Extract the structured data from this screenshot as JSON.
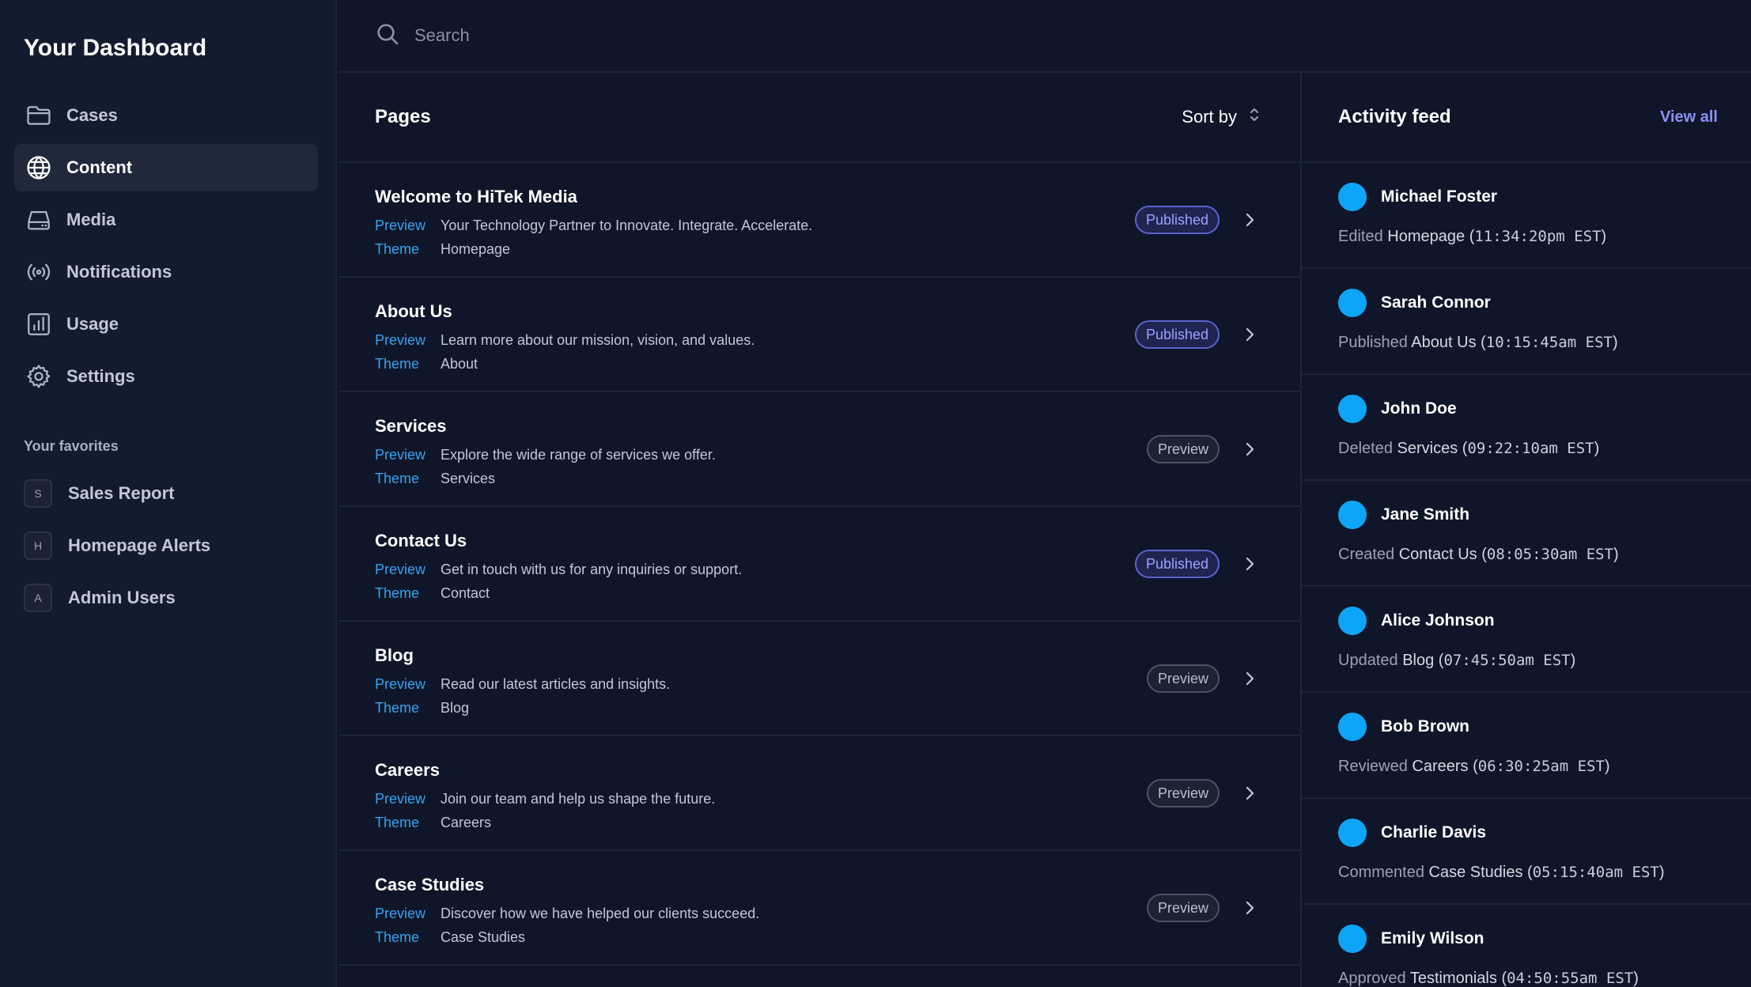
{
  "sidebar": {
    "title": "Your Dashboard",
    "items": [
      {
        "label": "Cases",
        "icon": "folder-icon"
      },
      {
        "label": "Content",
        "icon": "globe-icon"
      },
      {
        "label": "Media",
        "icon": "hard-drive-icon"
      },
      {
        "label": "Notifications",
        "icon": "signal-icon"
      },
      {
        "label": "Usage",
        "icon": "chart-icon"
      },
      {
        "label": "Settings",
        "icon": "gear-icon"
      }
    ],
    "active": "Content",
    "favorites_title": "Your favorites",
    "favorites": [
      {
        "initial": "S",
        "label": "Sales Report"
      },
      {
        "initial": "H",
        "label": "Homepage Alerts"
      },
      {
        "initial": "A",
        "label": "Admin Users"
      }
    ]
  },
  "search": {
    "placeholder": "Search"
  },
  "pages": {
    "title": "Pages",
    "sort_label": "Sort by",
    "preview_key": "Preview",
    "theme_key": "Theme",
    "rows": [
      {
        "name": "Welcome to HiTek Media",
        "preview": "Your Technology Partner to Innovate. Integrate. Accelerate.",
        "theme": "Homepage",
        "status": "Published"
      },
      {
        "name": "About Us",
        "preview": "Learn more about our mission, vision, and values.",
        "theme": "About",
        "status": "Published"
      },
      {
        "name": "Services",
        "preview": "Explore the wide range of services we offer.",
        "theme": "Services",
        "status": "Preview"
      },
      {
        "name": "Contact Us",
        "preview": "Get in touch with us for any inquiries or support.",
        "theme": "Contact",
        "status": "Published"
      },
      {
        "name": "Blog",
        "preview": "Read our latest articles and insights.",
        "theme": "Blog",
        "status": "Preview"
      },
      {
        "name": "Careers",
        "preview": "Join our team and help us shape the future.",
        "theme": "Careers",
        "status": "Preview"
      },
      {
        "name": "Case Studies",
        "preview": "Discover how we have helped our clients succeed.",
        "theme": "Case Studies",
        "status": "Preview"
      }
    ]
  },
  "feed": {
    "title": "Activity feed",
    "view_all": "View all",
    "items": [
      {
        "user": "Michael Foster",
        "action": "Edited",
        "object": "Homepage",
        "time": "11:34:20pm EST"
      },
      {
        "user": "Sarah Connor",
        "action": "Published",
        "object": "About Us",
        "time": "10:15:45am EST"
      },
      {
        "user": "John Doe",
        "action": "Deleted",
        "object": "Services",
        "time": "09:22:10am EST"
      },
      {
        "user": "Jane Smith",
        "action": "Created",
        "object": "Contact Us",
        "time": "08:05:30am EST"
      },
      {
        "user": "Alice Johnson",
        "action": "Updated",
        "object": "Blog",
        "time": "07:45:50am EST"
      },
      {
        "user": "Bob Brown",
        "action": "Reviewed",
        "object": "Careers",
        "time": "06:30:25am EST"
      },
      {
        "user": "Charlie Davis",
        "action": "Commented",
        "object": "Case Studies",
        "time": "05:15:40am EST"
      },
      {
        "user": "Emily Wilson",
        "action": "Approved",
        "object": "Testimonials",
        "time": "04:50:55am EST"
      }
    ]
  },
  "colors": {
    "background": "#0f1629",
    "sidebar": "#131b2f",
    "link": "#35a3f0",
    "accent": "#8b8ff5",
    "avatar": "#0ea5f6"
  }
}
